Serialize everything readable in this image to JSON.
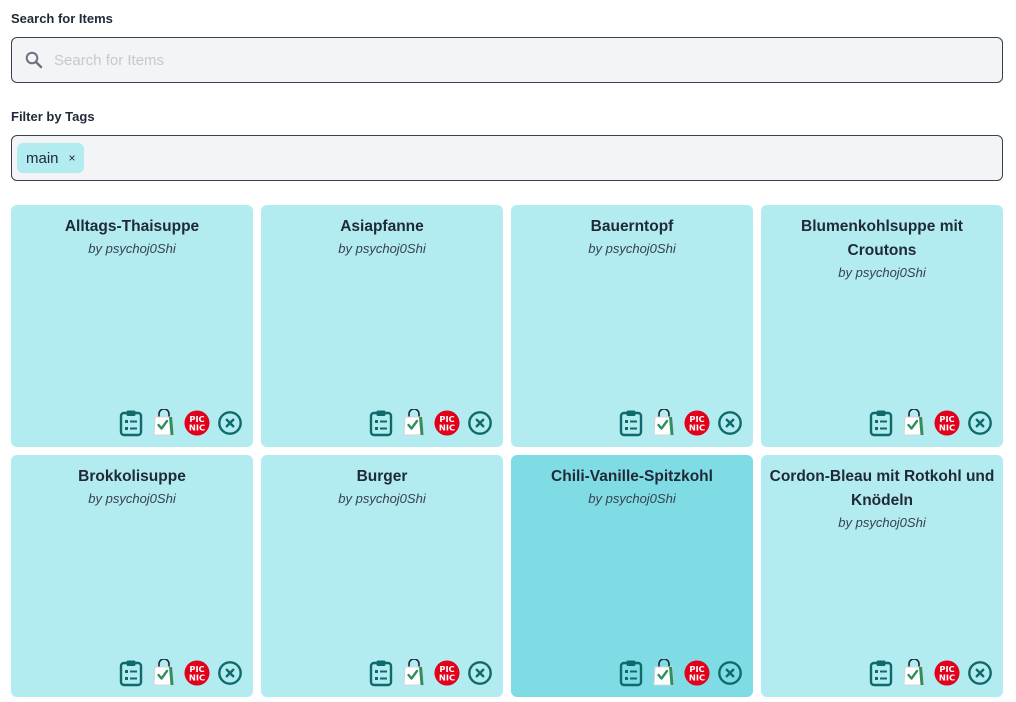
{
  "search": {
    "label": "Search for Items",
    "placeholder": "Search for Items",
    "value": ""
  },
  "tags": {
    "label": "Filter by Tags",
    "selected": [
      "main"
    ],
    "remove_glyph": "×"
  },
  "colors": {
    "card_bg": "#b2ebf0",
    "card_hover_bg": "#80dce4",
    "icon_teal": "#0f6b6b",
    "picnic_red": "#e2001a"
  },
  "items": [
    {
      "title": "Alltags-Thaisuppe",
      "author": "by psychoj0Shi",
      "active": false
    },
    {
      "title": "Asiapfanne",
      "author": "by psychoj0Shi",
      "active": false
    },
    {
      "title": "Bauerntopf",
      "author": "by psychoj0Shi",
      "active": false
    },
    {
      "title": "Blumenkohlsuppe mit Croutons",
      "author": "by psychoj0Shi",
      "active": false
    },
    {
      "title": "Brokkolisuppe",
      "author": "by psychoj0Shi",
      "active": false
    },
    {
      "title": "Burger",
      "author": "by psychoj0Shi",
      "active": false
    },
    {
      "title": "Chili-Vanille-Spitzkohl",
      "author": "by psychoj0Shi",
      "active": true
    },
    {
      "title": "Cordon-Bleau mit Rotkohl und Knödeln",
      "author": "by psychoj0Shi",
      "active": false
    }
  ],
  "card_actions": [
    {
      "icon": "clipboard-list-icon"
    },
    {
      "icon": "shopping-bag-check-icon"
    },
    {
      "icon": "picnic-logo-icon",
      "logo_text": [
        "PIC",
        "NIC"
      ]
    },
    {
      "icon": "close-circle-icon"
    }
  ]
}
